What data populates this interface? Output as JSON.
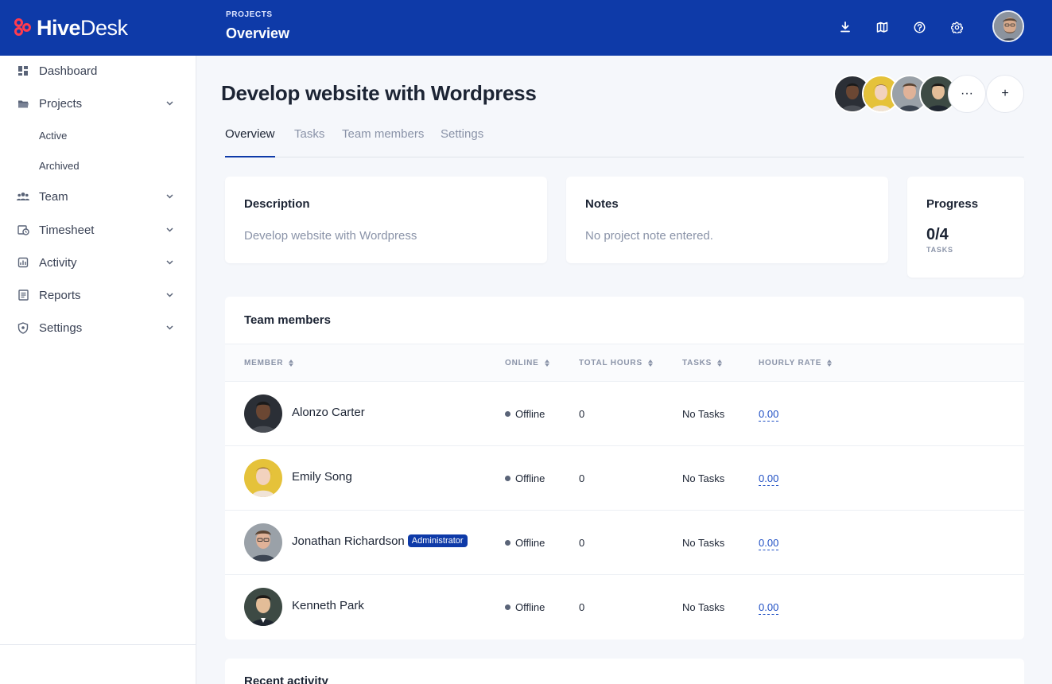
{
  "brand": {
    "name_bold": "Hive",
    "name_light": "Desk",
    "accent": "#ff3b4e",
    "header_color": "#0e3aa8"
  },
  "header": {
    "section": "PROJECTS",
    "title": "Overview",
    "icons": [
      "download-icon",
      "map-icon",
      "help-icon",
      "gear-icon"
    ]
  },
  "sidebar": {
    "items": [
      {
        "label": "Dashboard",
        "icon": "dashboard-icon"
      },
      {
        "label": "Projects",
        "icon": "folder-icon"
      },
      {
        "label": "Team",
        "icon": "team-icon"
      },
      {
        "label": "Timesheet",
        "icon": "timesheet-icon"
      },
      {
        "label": "Activity",
        "icon": "activity-icon"
      },
      {
        "label": "Reports",
        "icon": "reports-icon"
      },
      {
        "label": "Settings",
        "icon": "shield-icon"
      }
    ],
    "project_subitems": [
      "Active",
      "Archived"
    ]
  },
  "project": {
    "title": "Develop website with Wordpress",
    "more_label": "···",
    "add_label": "+"
  },
  "tabs": [
    "Overview",
    "Tasks",
    "Team members",
    "Settings"
  ],
  "cards": {
    "description": {
      "title": "Description",
      "body": "Develop website with Wordpress"
    },
    "notes": {
      "title": "Notes",
      "body": "No project note entered."
    },
    "progress": {
      "title": "Progress",
      "value": "0/4",
      "unit": "TASKS"
    }
  },
  "team": {
    "title": "Team members",
    "columns": [
      "MEMBER",
      "ONLINE",
      "TOTAL HOURS",
      "TASKS",
      "HOURLY RATE"
    ],
    "rows": [
      {
        "name": "Alonzo Carter",
        "badge": "",
        "online": "Offline",
        "hours": "0",
        "tasks": "No Tasks",
        "rate": "0.00"
      },
      {
        "name": "Emily Song",
        "badge": "",
        "online": "Offline",
        "hours": "0",
        "tasks": "No Tasks",
        "rate": "0.00"
      },
      {
        "name": "Jonathan Richardson",
        "badge": "Administrator",
        "online": "Offline",
        "hours": "0",
        "tasks": "No Tasks",
        "rate": "0.00"
      },
      {
        "name": "Kenneth Park",
        "badge": "",
        "online": "Offline",
        "hours": "0",
        "tasks": "No Tasks",
        "rate": "0.00"
      }
    ]
  },
  "recent": {
    "title": "Recent activity"
  }
}
